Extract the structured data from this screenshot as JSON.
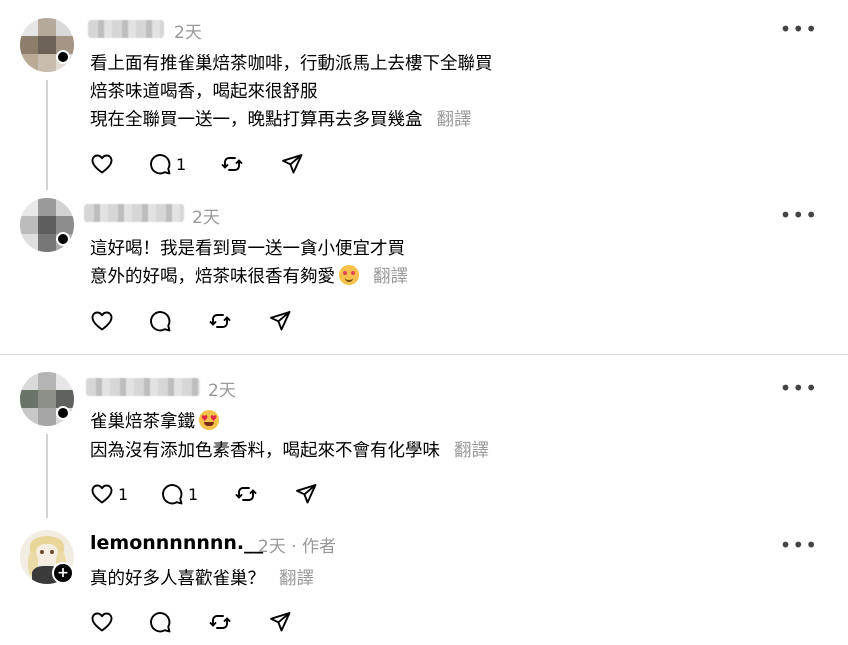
{
  "posts": [
    {
      "time": "2天",
      "lines": [
        "看上面有推雀巢焙茶咖啡，行動派馬上去樓下全聯買",
        "焙茶味道喝香，喝起來很舒服",
        "現在全聯買一送一，晚點打算再去多買幾盒"
      ],
      "translate": "翻譯",
      "comments": "1"
    },
    {
      "time": "2天",
      "lines": [
        "這好喝！我是看到買一送一貪小便宜才買",
        "意外的好喝，焙茶味很香有夠愛"
      ],
      "translate": "翻譯"
    },
    {
      "time": "2天",
      "lines": [
        "雀巢焙茶拿鐵",
        "因為沒有添加色素香料，喝起來不會有化學味"
      ],
      "translate": "翻譯",
      "likes": "1",
      "comments": "1"
    },
    {
      "username": "lemonnnnnnn.__",
      "time": "2天",
      "author_badge": "作者",
      "lines": [
        "真的好多人喜歡雀巢？"
      ],
      "translate": "翻譯"
    }
  ],
  "icons": [
    "heart-icon",
    "comment-icon",
    "repost-icon",
    "share-icon",
    "more-icon",
    "follow-plus-icon"
  ],
  "colors": {
    "muted": "#999999",
    "divider": "#d8d8d8",
    "thread_line": "#d4d4d4"
  }
}
